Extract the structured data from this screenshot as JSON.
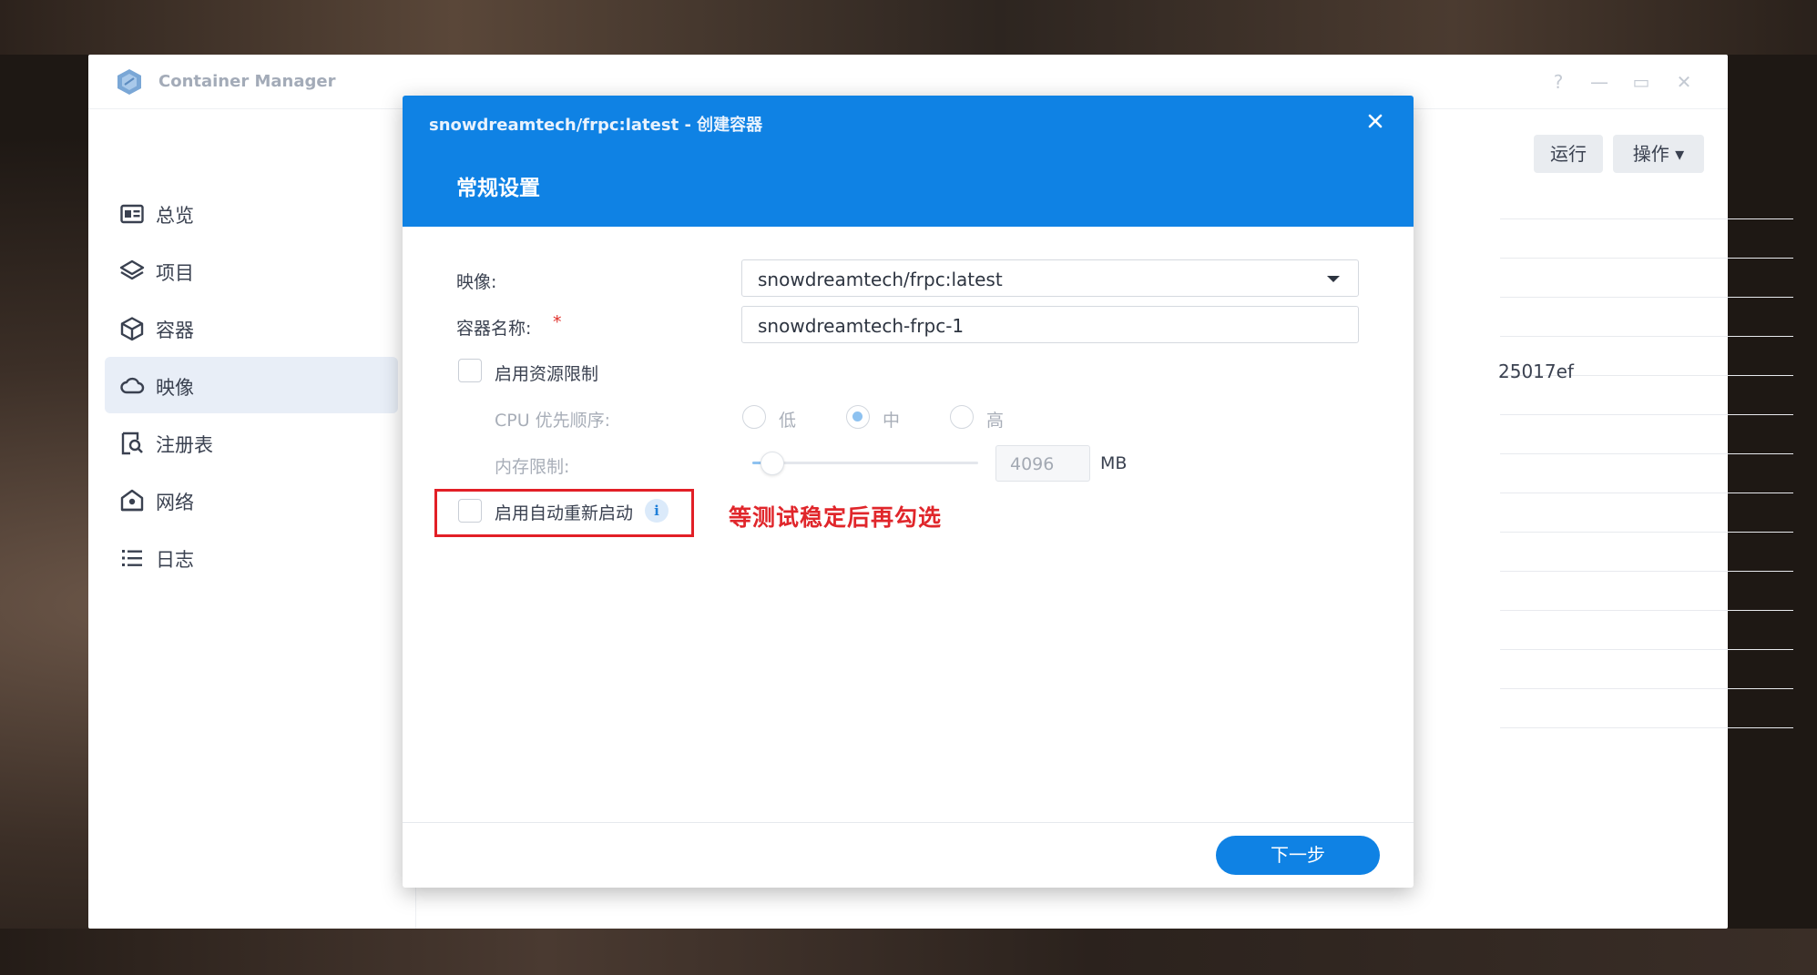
{
  "app": {
    "title": "Container Manager",
    "window_controls": [
      "?",
      "—",
      "▭",
      "✕"
    ]
  },
  "sidebar": {
    "items": [
      {
        "label": "总览",
        "icon": "overview-icon",
        "active": false
      },
      {
        "label": "项目",
        "icon": "layers-icon",
        "active": false
      },
      {
        "label": "容器",
        "icon": "box-icon",
        "active": false
      },
      {
        "label": "映像",
        "icon": "cloud-icon",
        "active": true
      },
      {
        "label": "注册表",
        "icon": "registry-search-icon",
        "active": false
      },
      {
        "label": "网络",
        "icon": "network-house-icon",
        "active": false
      },
      {
        "label": "日志",
        "icon": "list-icon",
        "active": false
      }
    ]
  },
  "toolbar": {
    "run_label": "运行",
    "actions_label": "操作 ▾"
  },
  "background_table": {
    "visible_cell": "25017ef"
  },
  "dialog": {
    "title": "snowdreamtech/frpc:latest - 创建容器",
    "section": "常规设置",
    "image_label": "映像:",
    "image_value": "snowdreamtech/frpc:latest",
    "container_name_label": "容器名称:",
    "required_mark": "*",
    "container_name_value": "snowdreamtech-frpc-1",
    "resource_limit_label": "启用资源限制",
    "cpu_priority_label": "CPU 优先顺序:",
    "cpu_options": [
      "低",
      "中",
      "高"
    ],
    "cpu_selected": "中",
    "memory_limit_label": "内存限制:",
    "memory_value": "4096",
    "memory_unit": "MB",
    "memory_slider_fraction": 0.03,
    "auto_restart_label": "启用自动重新启动",
    "info_glyph": "i",
    "annotation": "等测试稳定后再勾选",
    "next_button": "下一步"
  },
  "colors": {
    "accent": "#0f82e4",
    "annotation_red": "#e21f26",
    "active_nav_bg": "#e8eef7"
  }
}
